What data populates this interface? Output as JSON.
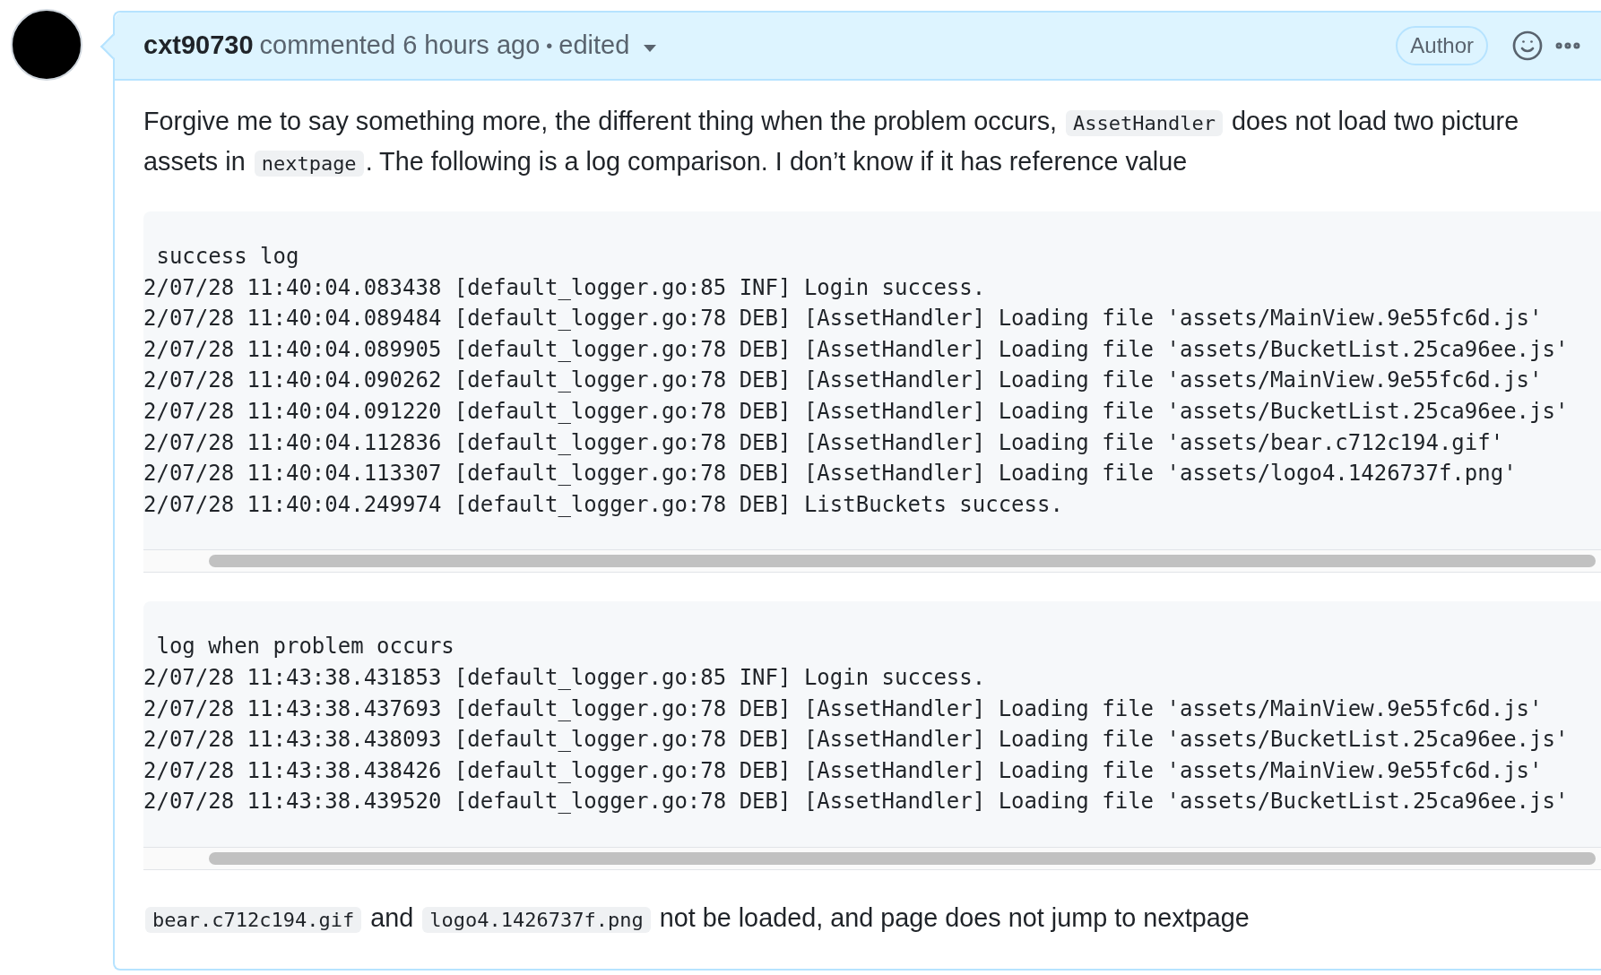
{
  "comment": {
    "author": "cxt90730",
    "action": "commented 6 hours ago",
    "separator": "•",
    "edited": "edited",
    "badge": "Author",
    "body": [
      {
        "kind": "paragraph",
        "parts": [
          {
            "kind": "text",
            "text": "Forgive me to say something more, the different thing when the problem occurs, "
          },
          {
            "kind": "code",
            "text": "AssetHandler"
          },
          {
            "kind": "text",
            "text": " does not load two picture assets in "
          },
          {
            "kind": "code",
            "text": "nextpage"
          },
          {
            "kind": "text",
            "text": ". The following is a log comparison. I don’t know if it has reference value"
          }
        ]
      },
      {
        "kind": "codeblock",
        "lines": [
          " success log",
          "2/07/28 11:40:04.083438 [default_logger.go:85 INF] Login success.",
          "2/07/28 11:40:04.089484 [default_logger.go:78 DEB] [AssetHandler] Loading file 'assets/MainView.9e55fc6d.js'",
          "2/07/28 11:40:04.089905 [default_logger.go:78 DEB] [AssetHandler] Loading file 'assets/BucketList.25ca96ee.js'",
          "2/07/28 11:40:04.090262 [default_logger.go:78 DEB] [AssetHandler] Loading file 'assets/MainView.9e55fc6d.js'",
          "2/07/28 11:40:04.091220 [default_logger.go:78 DEB] [AssetHandler] Loading file 'assets/BucketList.25ca96ee.js'",
          "2/07/28 11:40:04.112836 [default_logger.go:78 DEB] [AssetHandler] Loading file 'assets/bear.c712c194.gif'",
          "2/07/28 11:40:04.113307 [default_logger.go:78 DEB] [AssetHandler] Loading file 'assets/logo4.1426737f.png'",
          "2/07/28 11:40:04.249974 [default_logger.go:78 DEB] ListBuckets success."
        ]
      },
      {
        "kind": "codeblock",
        "lines": [
          " log when problem occurs",
          "2/07/28 11:43:38.431853 [default_logger.go:85 INF] Login success.",
          "2/07/28 11:43:38.437693 [default_logger.go:78 DEB] [AssetHandler] Loading file 'assets/MainView.9e55fc6d.js'",
          "2/07/28 11:43:38.438093 [default_logger.go:78 DEB] [AssetHandler] Loading file 'assets/BucketList.25ca96ee.js'",
          "2/07/28 11:43:38.438426 [default_logger.go:78 DEB] [AssetHandler] Loading file 'assets/MainView.9e55fc6d.js'",
          "2/07/28 11:43:38.439520 [default_logger.go:78 DEB] [AssetHandler] Loading file 'assets/BucketList.25ca96ee.js'"
        ]
      },
      {
        "kind": "paragraph",
        "parts": [
          {
            "kind": "code",
            "text": "bear.c712c194.gif"
          },
          {
            "kind": "text",
            "text": " and "
          },
          {
            "kind": "code",
            "text": "logo4.1426737f.png"
          },
          {
            "kind": "text",
            "text": " not be loaded, and page does not jump to nextpage"
          }
        ]
      }
    ]
  }
}
